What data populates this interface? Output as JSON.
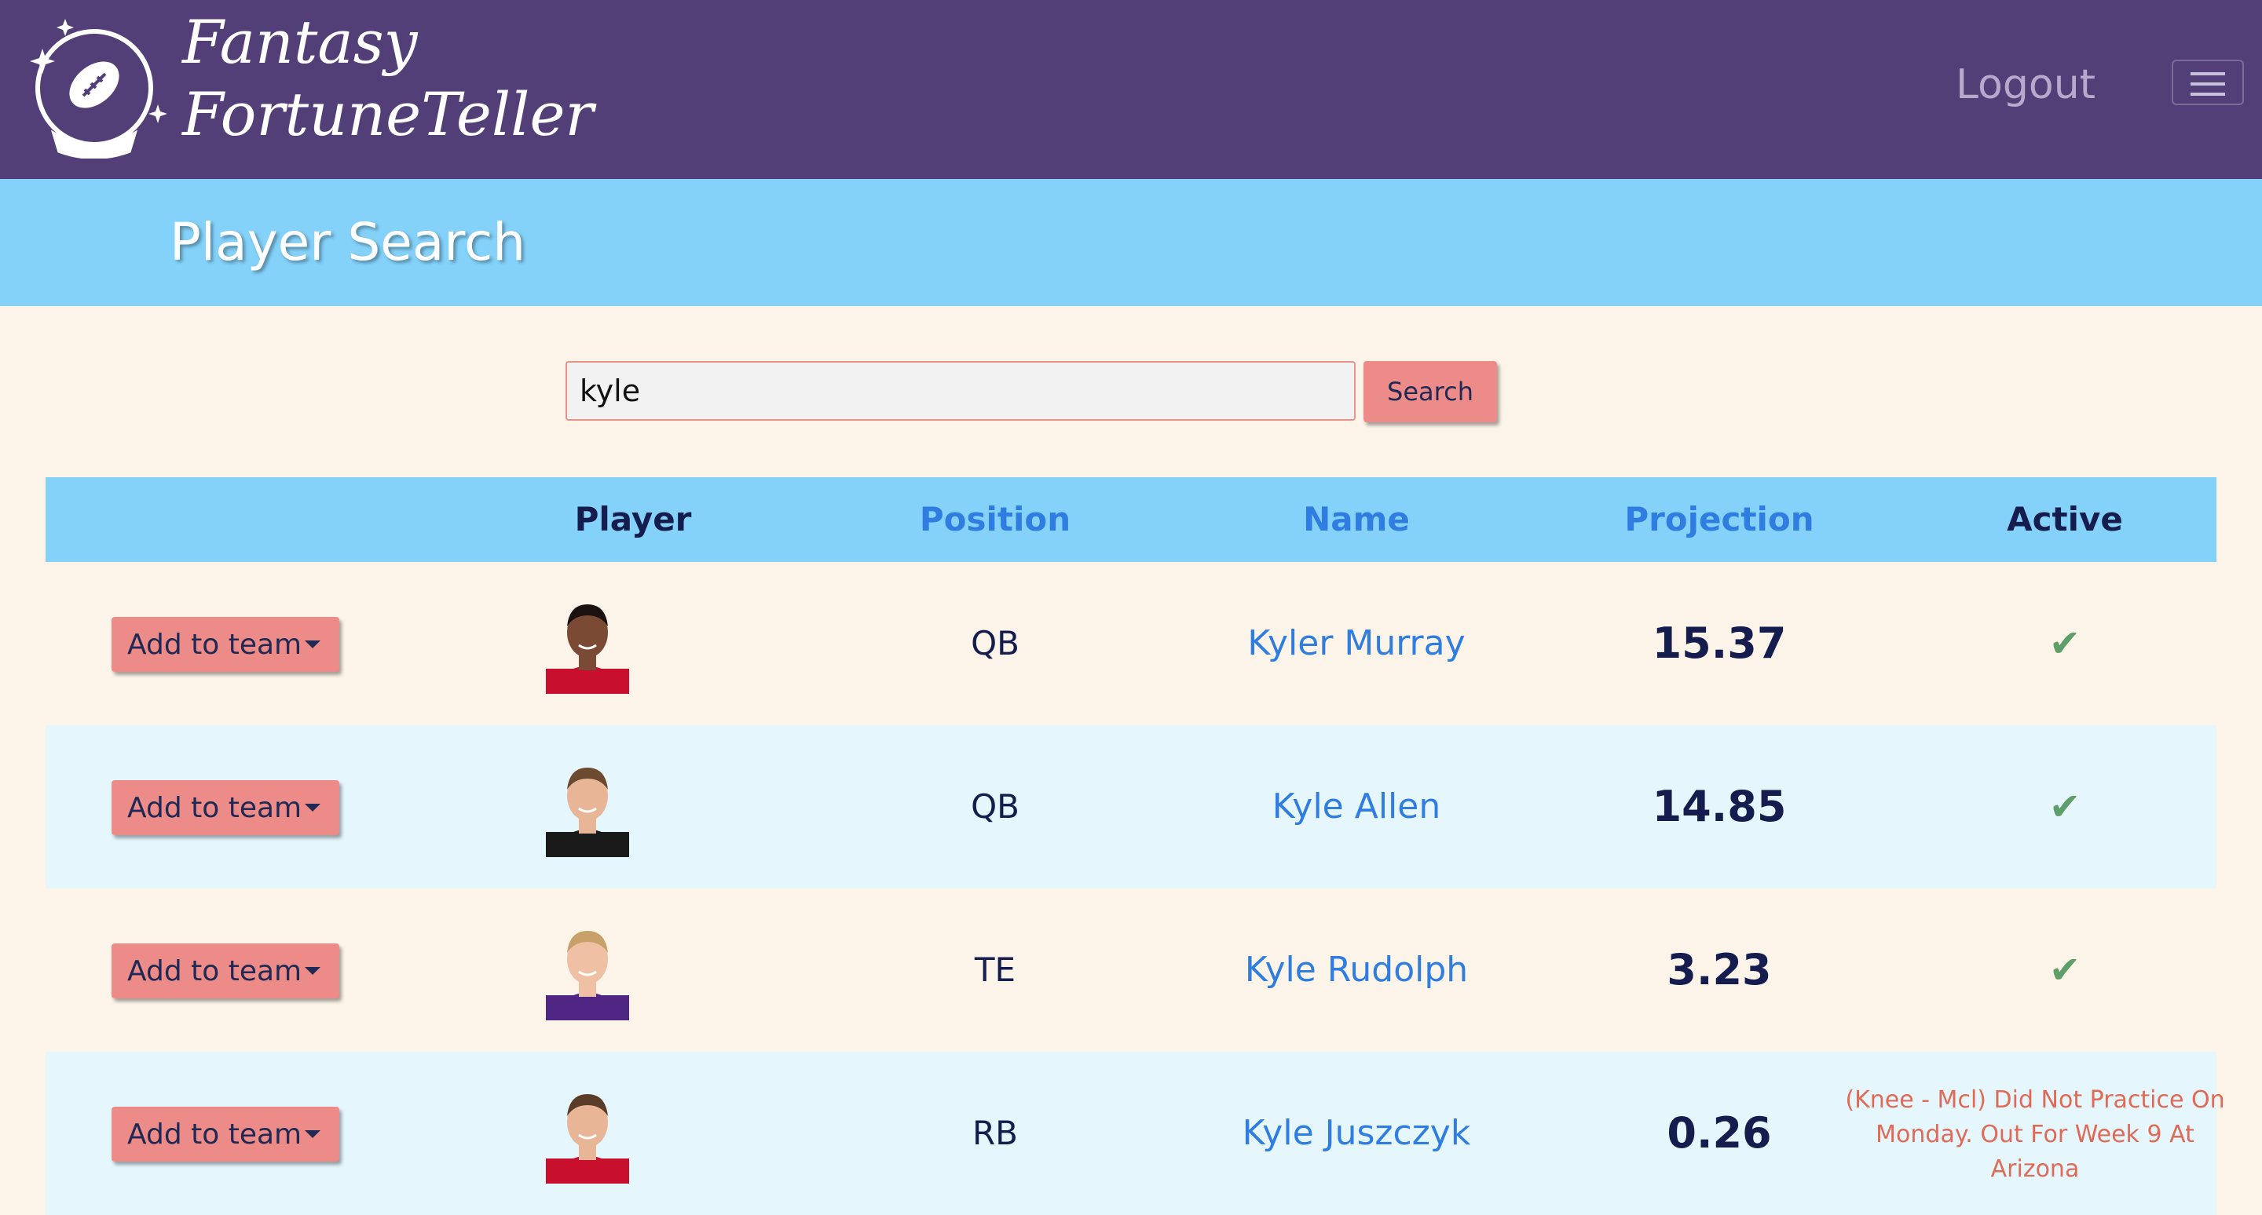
{
  "navbar": {
    "brand_line1": "Fantasy",
    "brand_line2": "FortuneTeller",
    "logout_label": "Logout",
    "colors": {
      "background": "#533f78",
      "logout": "#b6a9cc"
    }
  },
  "page": {
    "title": "Player Search",
    "colors": {
      "banner": "#84d2fa",
      "background": "#fcf4e8",
      "accent_button": "#ec8b88"
    }
  },
  "search": {
    "value": "kyle",
    "button_label": "Search"
  },
  "table": {
    "headers": {
      "player": "Player",
      "position": "Position",
      "name": "Name",
      "projection": "Projection",
      "active": "Active"
    },
    "add_label": "Add to team",
    "rows": [
      {
        "position": "QB",
        "name": "Kyler Murray",
        "projection": "15.37",
        "active": "✔",
        "status": "",
        "jersey": "#c8102e",
        "skin": "#7a4a34",
        "hair": "#1a1210"
      },
      {
        "position": "QB",
        "name": "Kyle Allen",
        "projection": "14.85",
        "active": "✔",
        "status": "",
        "jersey": "#1a1a1a",
        "skin": "#e8b596",
        "hair": "#6b4a2f"
      },
      {
        "position": "TE",
        "name": "Kyle Rudolph",
        "projection": "3.23",
        "active": "✔",
        "status": "",
        "jersey": "#4f2683",
        "skin": "#f0c0a4",
        "hair": "#c7a06a"
      },
      {
        "position": "RB",
        "name": "Kyle Juszczyk",
        "projection": "0.26",
        "active": "",
        "status": "(Knee - Mcl) Did Not Practice On Monday. Out For Week 9 At Arizona",
        "jersey": "#c8102e",
        "skin": "#e8b596",
        "hair": "#5a3d28"
      }
    ]
  }
}
